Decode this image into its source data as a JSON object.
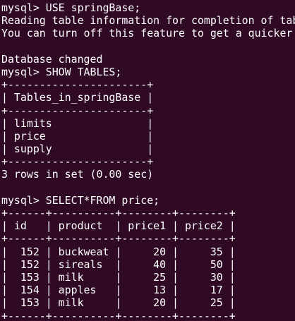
{
  "terminal": {
    "background": "#300a24",
    "foreground": "#ffffff",
    "lines": [
      "mysql> USE springBase;",
      "Reading table information for completion of table and column names",
      "You can turn off this feature to get a quicker startup with -A",
      "",
      "Database changed",
      "mysql> SHOW TABLES;",
      "+----------------------+",
      "| Tables_in_springBase |",
      "+----------------------+",
      "| limits               |",
      "| price                |",
      "| supply               |",
      "+----------------------+",
      "3 rows in set (0.00 sec)",
      "",
      "mysql> SELECT*FROM price;",
      "+------+----------+--------+--------+",
      "| id   | product  | price1 | price2 |",
      "+------+----------+--------+--------+",
      "|  152 | buckweat |     20 |     35 |",
      "|  152 | sireals  |     40 |     50 |",
      "|  153 | milk     |     25 |     30 |",
      "|  154 | apples   |     13 |     17 |",
      "|  153 | milk     |     20 |     25 |",
      "+------+----------+--------+--------+"
    ]
  }
}
